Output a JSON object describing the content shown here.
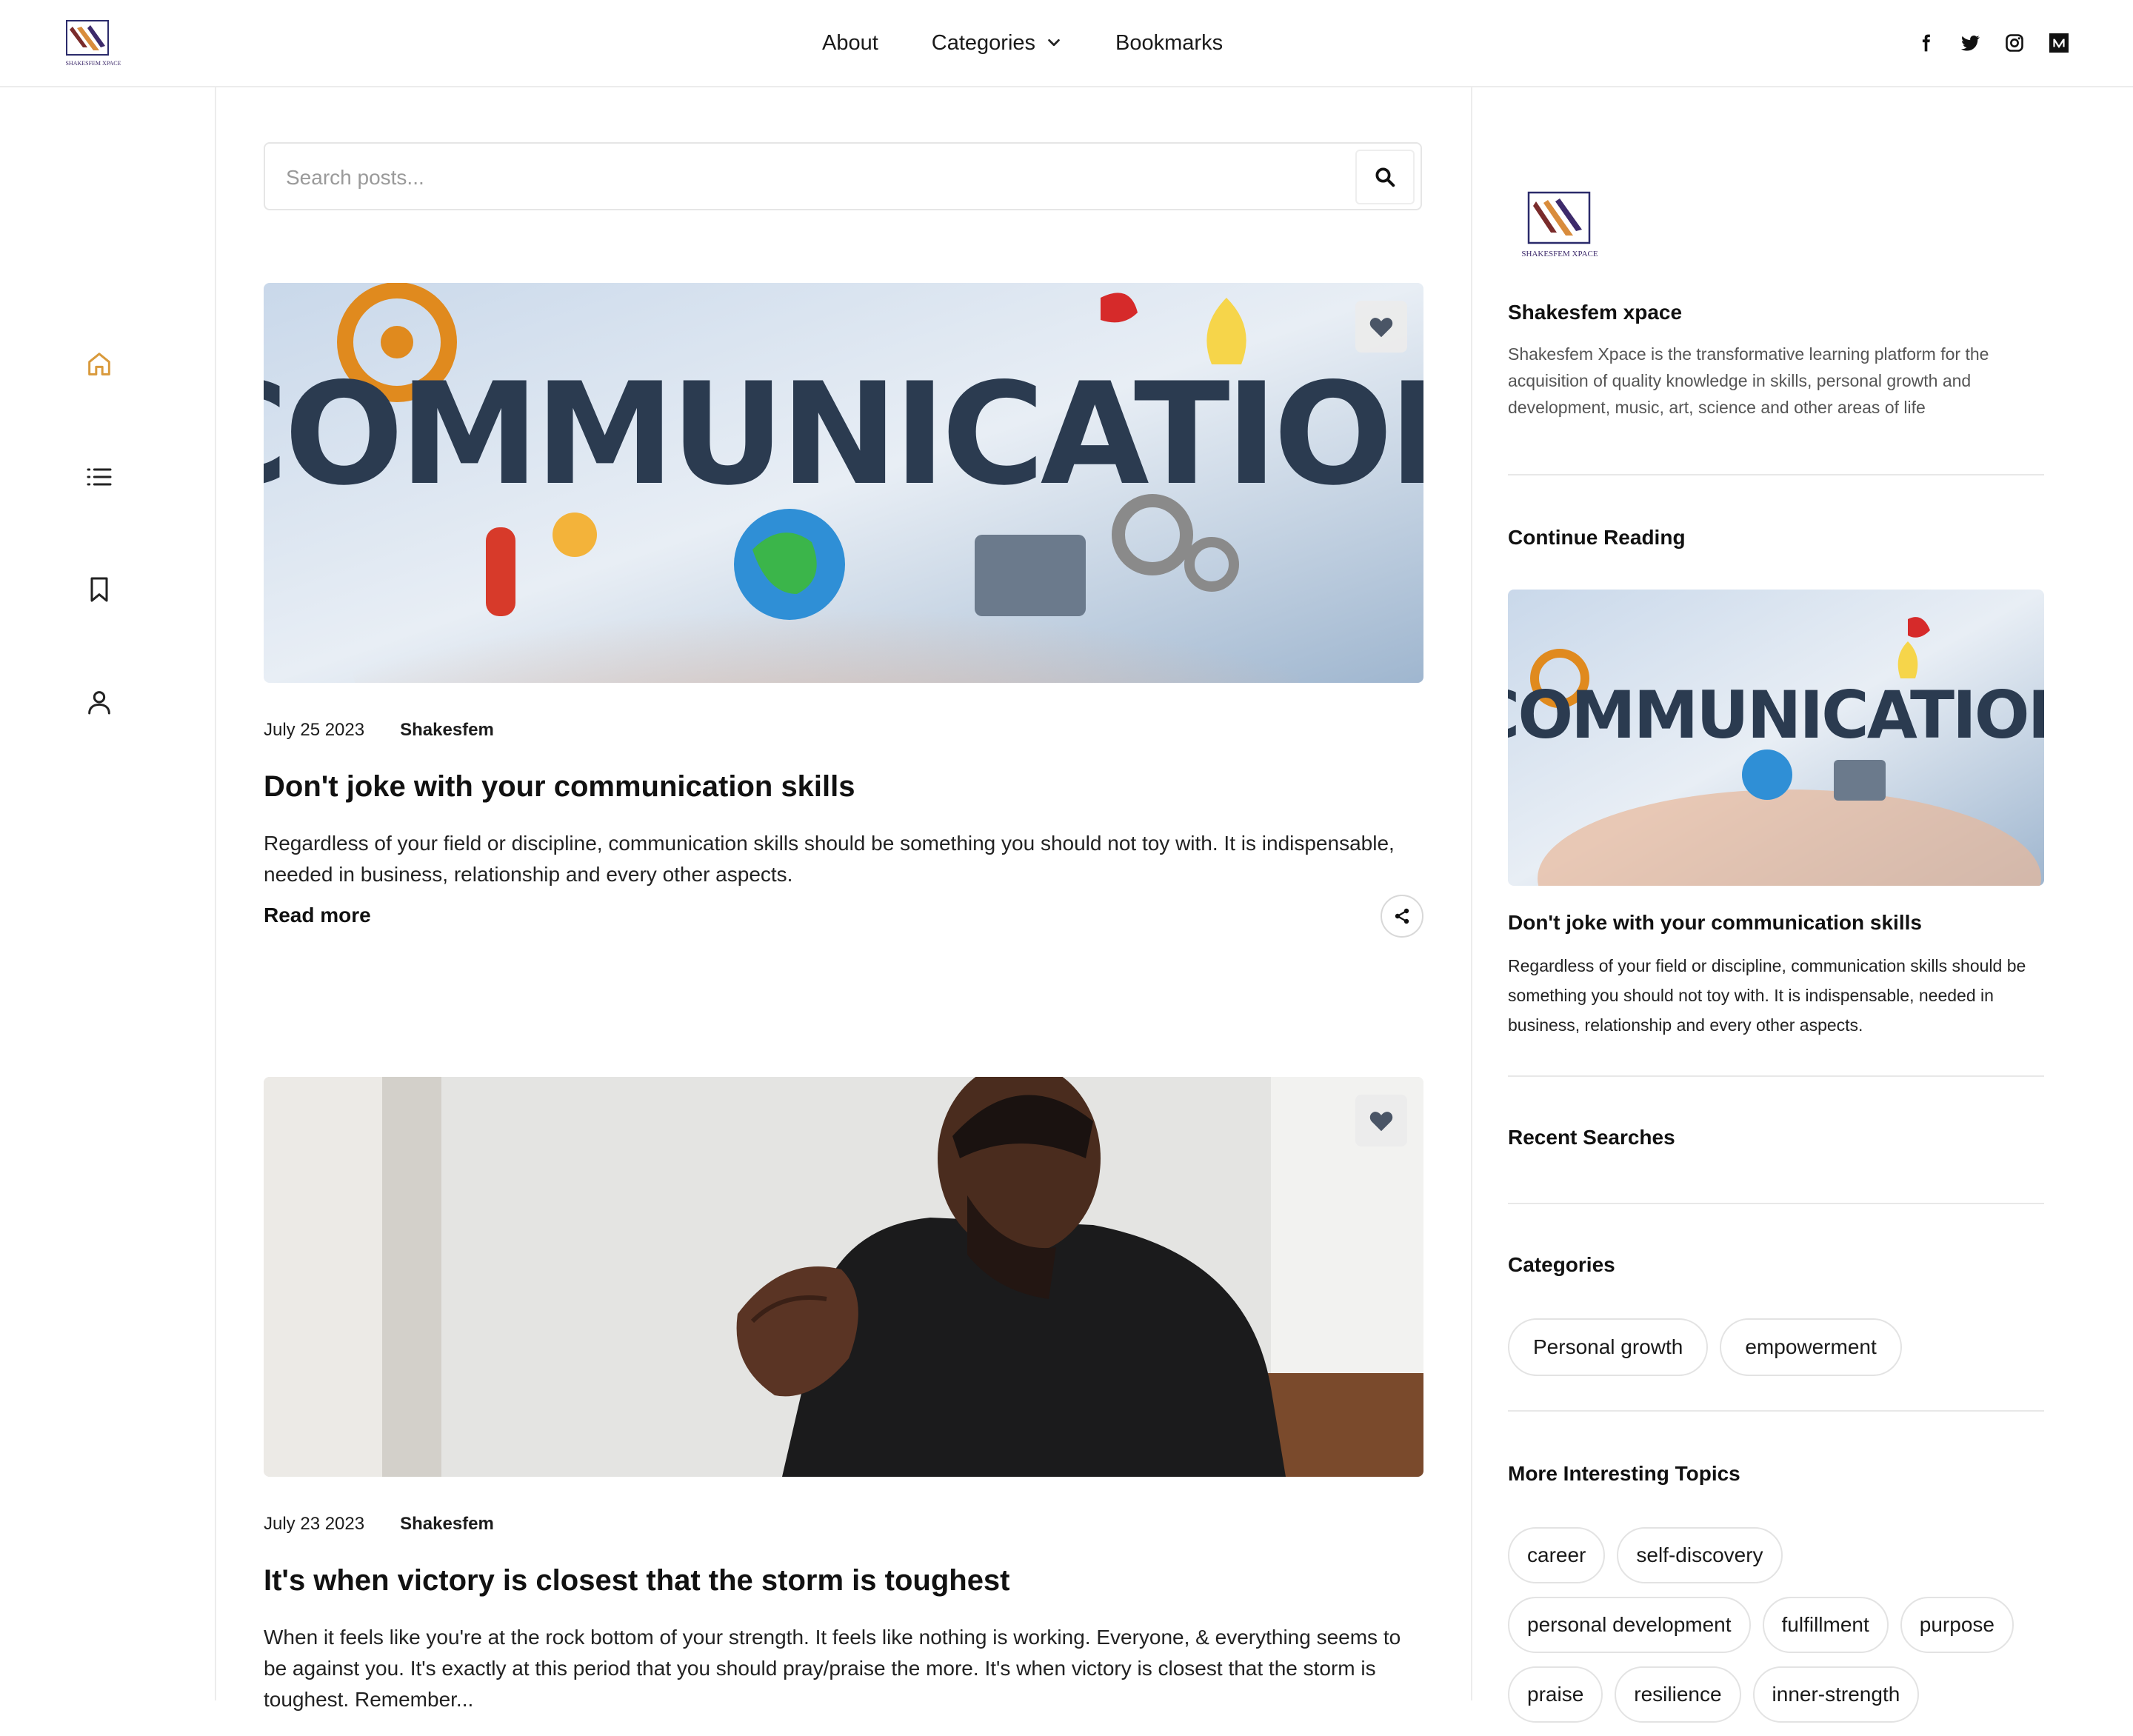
{
  "header": {
    "logo_text": "SHAKESFEM XPACE",
    "nav": [
      {
        "label": "About"
      },
      {
        "label": "Categories"
      },
      {
        "label": "Bookmarks"
      }
    ],
    "social": [
      "facebook-icon",
      "twitter-icon",
      "instagram-icon",
      "medium-icon"
    ]
  },
  "rail": {
    "icons": [
      "home-icon",
      "list-icon",
      "bookmark-icon",
      "user-icon"
    ],
    "active_color": "#d99a3c"
  },
  "search": {
    "placeholder": "Search posts..."
  },
  "posts": [
    {
      "date": "July 25 2023",
      "author": "Shakesfem",
      "title": "Don't joke with your communication skills",
      "excerpt": "Regardless of your field or discipline, communication skills should be something you should not toy with. It is indispensable, needed in business, relationship and every other aspects.",
      "read_more": "Read more",
      "image_text": "COMMUNICATION"
    },
    {
      "date": "July 23 2023",
      "author": "Shakesfem",
      "title": "It's when victory is closest that the storm is toughest",
      "excerpt": "When it feels like you're at the rock bottom of your strength. It feels like nothing is working. Everyone, & everything seems to be against you. It's exactly at this period that you should pray/praise the more. It's when victory is closest that the storm is toughest. Remember..."
    }
  ],
  "sidebar": {
    "logo_text": "SHAKESFEM XPACE",
    "site_name": "Shakesfem xpace",
    "site_desc": "Shakesfem Xpace is the transformative learning platform for the acquisition of quality knowledge in skills, personal growth and development, music, art, science and other areas of life",
    "continue_heading": "Continue Reading",
    "continue_post": {
      "title": "Don't joke with your communication skills",
      "excerpt": "Regardless of your field or discipline, communication skills should be something you should not toy with. It is indispensable, needed in business, relationship and every other aspects.",
      "image_text": "COMMUNICATION"
    },
    "recent_heading": "Recent Searches",
    "categories_heading": "Categories",
    "categories": [
      "Personal growth",
      "empowerment"
    ],
    "topics_heading": "More Interesting Topics",
    "topics": [
      "career",
      "self-discovery",
      "personal development",
      "fulfillment",
      "purpose",
      "praise",
      "resilience",
      "inner-strength"
    ]
  }
}
